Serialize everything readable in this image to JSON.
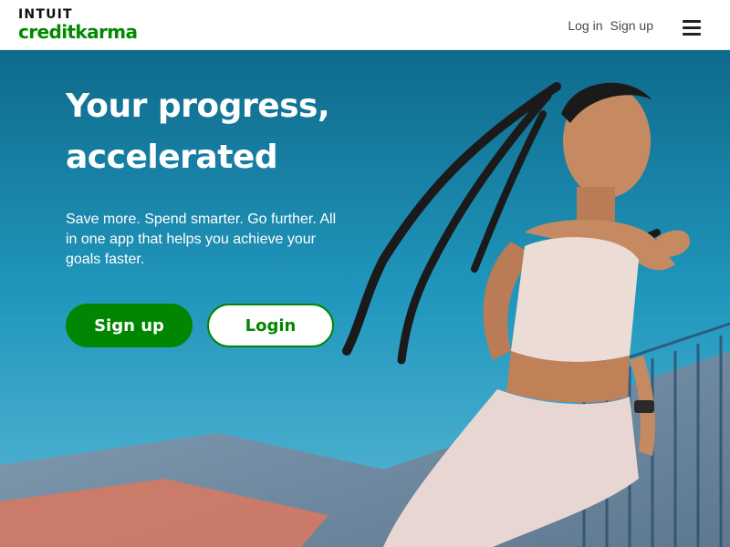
{
  "header": {
    "logo_top": "INTUIT",
    "logo_bottom": "creditkarma",
    "nav": {
      "login": "Log in",
      "signup": "Sign up"
    }
  },
  "hero": {
    "title": "Your progress, accelerated",
    "subtitle": "Save more. Spend smarter. Go further. All in one app that helps you achieve your goals faster.",
    "signup_button": "Sign up",
    "login_button": "Login"
  },
  "icons": {
    "menu": "hamburger-menu-icon"
  },
  "colors": {
    "brand_green": "#008600",
    "sky_blue": "#1e90b6",
    "header_bg": "#ffffff",
    "text_white": "#ffffff"
  }
}
